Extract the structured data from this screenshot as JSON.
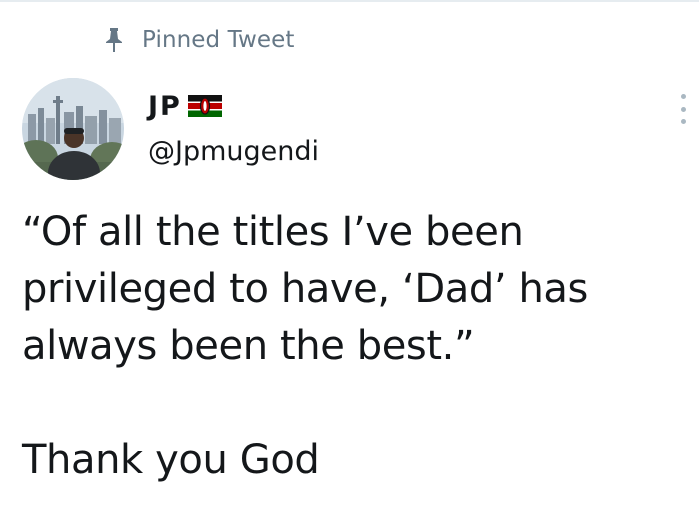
{
  "pinned": {
    "label": "Pinned Tweet",
    "icon": "pin-icon"
  },
  "author": {
    "display_name": "JP",
    "flag_icon": "kenya-flag-icon",
    "handle": "@Jpmugendi",
    "avatar_icon": "avatar"
  },
  "menu": {
    "icon": "more-options-icon"
  },
  "tweet": {
    "text": "“Of all the titles I’ve been\nprivileged to have, ‘Dad’ has\nalways been the best.”\n\nThank you God"
  },
  "colors": {
    "text": "#14171a",
    "secondary": "#657786",
    "divider": "#e6ecf0",
    "menu_dots": "#aab8c2"
  }
}
